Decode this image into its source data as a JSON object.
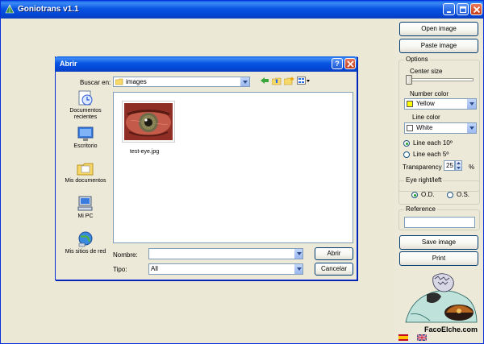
{
  "app": {
    "title": "Goniotrans v1.1",
    "title_buttons": [
      "minimize-icon",
      "maximize-icon",
      "close-icon"
    ]
  },
  "right_panel": {
    "open_image": "Open image",
    "paste_image": "Paste image",
    "options": {
      "label": "Options",
      "center_size_label": "Center size",
      "center_size_value": 0.05,
      "number_color_label": "Number color",
      "number_color_value": "Yellow",
      "number_color_swatch": "#ffff00",
      "line_color_label": "Line color",
      "line_color_value": "White",
      "line_color_swatch": "#ffffff",
      "line_each_10": "Line each 10º",
      "line_each_5": "Line each 5º",
      "line_selected": "Line each 10º",
      "transparency_label": "Transparency",
      "transparency_value": "25",
      "transparency_unit": "%"
    },
    "eye": {
      "label": "Eye right/left",
      "od": "O.D.",
      "os": "O.S.",
      "selected": "O.D."
    },
    "reference": {
      "label": "Reference",
      "value": ""
    },
    "save_image": "Save image",
    "print": "Print",
    "brand": "FacoElche.com",
    "languages": [
      "es-flag-icon",
      "uk-flag-icon"
    ]
  },
  "dialog": {
    "title": "Abrir",
    "look_in_label": "Buscar en:",
    "look_in_value": "images",
    "places": [
      {
        "label": "Documentos recientes",
        "icon": "recent-documents-icon"
      },
      {
        "label": "Escritorio",
        "icon": "desktop-icon"
      },
      {
        "label": "Mis documentos",
        "icon": "my-documents-icon"
      },
      {
        "label": "Mi PC",
        "icon": "my-computer-icon"
      },
      {
        "label": "Mis sitios de red",
        "icon": "network-places-icon"
      }
    ],
    "files": [
      {
        "name": "test-eye.jpg"
      }
    ],
    "filename_label": "Nombre:",
    "filename_value": "",
    "filetype_label": "Tipo:",
    "filetype_value": "All",
    "open_button": "Abrir",
    "cancel_button": "Cancelar"
  },
  "colors": {
    "xp_blue": "#0054e3",
    "window_bg": "#ece9d8",
    "radio_dot": "#21a121"
  }
}
